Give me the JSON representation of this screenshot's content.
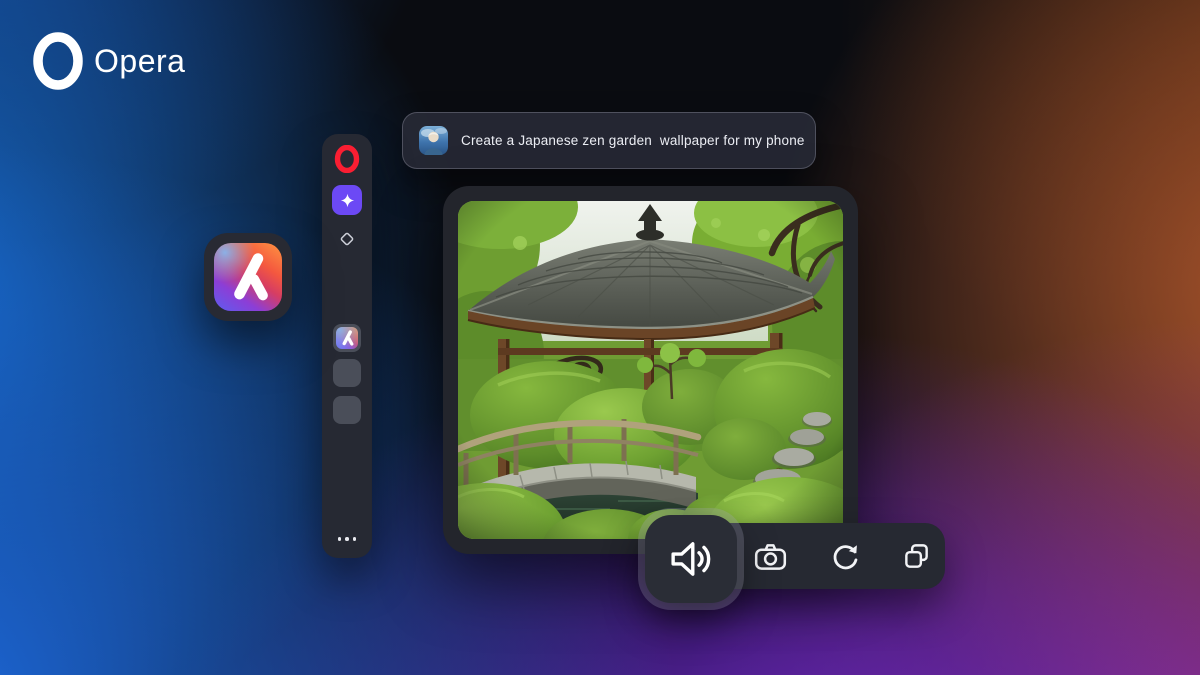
{
  "brand": {
    "name": "Opera",
    "logo_icon": "opera-ring-icon"
  },
  "prompt_bubble": {
    "avatar_icon": "user-avatar",
    "text": "Create a Japanese zen garden  wallpaper for my phone"
  },
  "sidebar": {
    "items": [
      {
        "id": "opera-menu",
        "icon": "opera-o-icon",
        "color": "#fa1e32"
      },
      {
        "id": "aria-ai",
        "icon": "sparkle-icon",
        "active": true,
        "accent": "#6c49f5"
      },
      {
        "id": "tab-diamond",
        "icon": "diamond-outline-icon"
      },
      {
        "id": "aria-app",
        "icon": "aria-logo-icon",
        "selected": true
      },
      {
        "id": "empty-slot-1",
        "icon": "placeholder-tile"
      },
      {
        "id": "empty-slot-2",
        "icon": "placeholder-tile"
      }
    ],
    "more_icon": "ellipsis-icon"
  },
  "floating_app": {
    "icon": "aria-logo-icon"
  },
  "generated_image": {
    "subject": "Japanese zen garden with pagoda gazebo, wooden bridge, stepping stones and moss"
  },
  "toolbar": {
    "buttons": [
      {
        "id": "read-aloud",
        "icon": "speaker-icon",
        "highlighted": true
      },
      {
        "id": "capture",
        "icon": "camera-icon"
      },
      {
        "id": "regenerate",
        "icon": "refresh-icon"
      },
      {
        "id": "copy",
        "icon": "copy-icon"
      }
    ]
  },
  "colors": {
    "accent_purple": "#6c49f5",
    "opera_red": "#fa1e32",
    "panel_dark": "#262933",
    "bubble_bg": "#272935",
    "toolbar_bg": "#262932",
    "background_blue": "#1b76e4",
    "background_purple": "#762ade",
    "background_magenta": "#ac3798",
    "background_rust": "#bc5c2e"
  }
}
